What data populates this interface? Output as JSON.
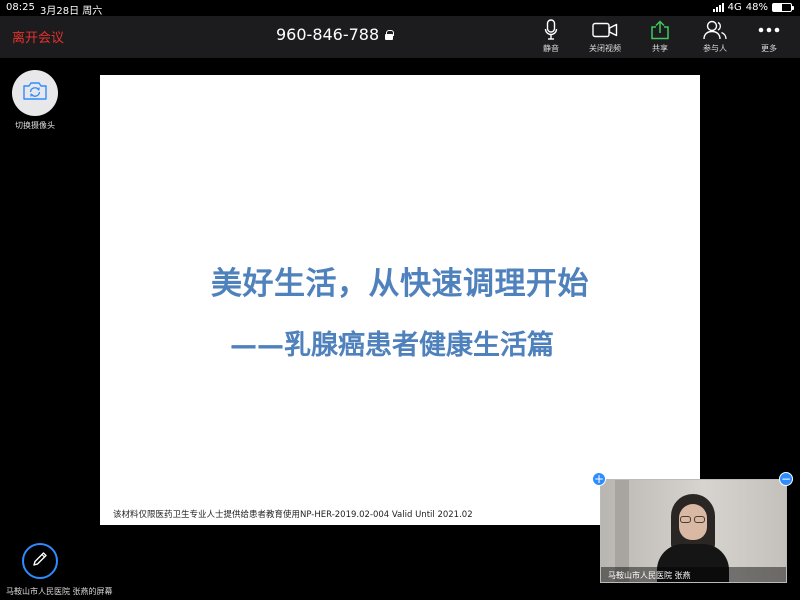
{
  "status_bar": {
    "time": "08:25",
    "date": "3月28日 周六",
    "network": "4G",
    "battery": "48%",
    "battery_level": 0.48
  },
  "toolbar": {
    "leave_label": "离开会议",
    "meeting_id": "960-846-788",
    "mute_label": "静音",
    "stop_video_label": "关闭视频",
    "share_label": "共享",
    "participants_label": "参与人",
    "more_label": "更多"
  },
  "left_controls": {
    "switch_camera_label": "切换摄像头"
  },
  "slide": {
    "title": "美好生活，从快速调理开始",
    "subtitle": "——乳腺癌患者健康生活篇",
    "footer": "该材料仅限医药卫生专业人士提供给患者教育使用NP-HER-2019.02-004 Valid Until 2021.02"
  },
  "screen_share": {
    "owner_label": "马鞍山市人民医院 张燕的屏幕"
  },
  "video_thumbnail": {
    "name": "马鞍山市人民医院 张燕",
    "expand_symbol": "+",
    "collapse_symbol": "−"
  },
  "colors": {
    "leave": "#e5322d",
    "share_icon": "#3fc85c",
    "slide_text": "#4f81bd",
    "accent": "#2d8cff"
  }
}
